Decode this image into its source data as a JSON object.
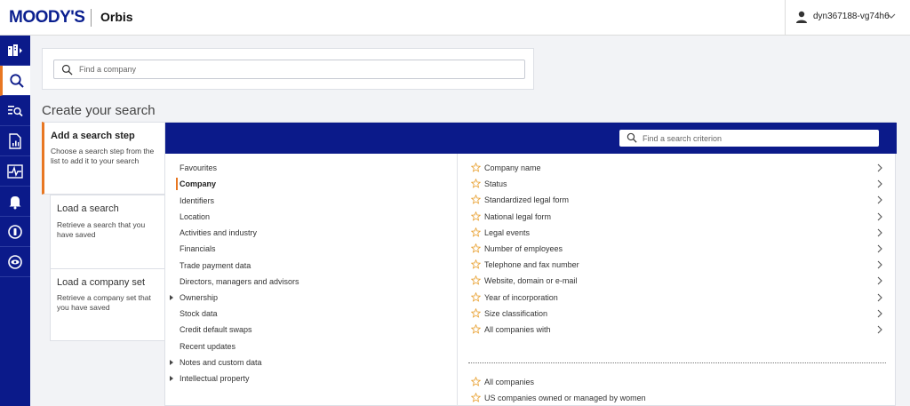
{
  "header": {
    "logo": "MOODY'S",
    "product": "Orbis",
    "user": "dyn367188-vg74h6"
  },
  "search": {
    "placeholder": "Find a company"
  },
  "section_title": "Create your search",
  "steps": [
    {
      "title": "Add a search step",
      "desc": "Choose a search step from the list to add it to your search"
    },
    {
      "title": "Load a search",
      "desc": "Retrieve a search that you have saved"
    },
    {
      "title": "Load a company set",
      "desc": "Retrieve a company set that you have saved"
    }
  ],
  "criterion_search": {
    "placeholder": "Find a search criterion"
  },
  "categories": [
    {
      "label": "Favourites",
      "expandable": false,
      "active": false
    },
    {
      "label": "Company",
      "expandable": false,
      "active": true
    },
    {
      "label": "Identifiers",
      "expandable": false,
      "active": false
    },
    {
      "label": "Location",
      "expandable": false,
      "active": false
    },
    {
      "label": "Activities and industry",
      "expandable": false,
      "active": false
    },
    {
      "label": "Financials",
      "expandable": false,
      "active": false
    },
    {
      "label": "Trade payment data",
      "expandable": false,
      "active": false
    },
    {
      "label": "Directors, managers and advisors",
      "expandable": false,
      "active": false
    },
    {
      "label": "Ownership",
      "expandable": true,
      "active": false
    },
    {
      "label": "Stock data",
      "expandable": false,
      "active": false
    },
    {
      "label": "Credit default swaps",
      "expandable": false,
      "active": false
    },
    {
      "label": "Recent updates",
      "expandable": false,
      "active": false
    },
    {
      "label": "Notes and custom data",
      "expandable": true,
      "active": false
    },
    {
      "label": "Intellectual property",
      "expandable": true,
      "active": false
    }
  ],
  "criteria": [
    "Company name",
    "Status",
    "Standardized legal form",
    "National legal form",
    "Legal events",
    "Number of employees",
    "Telephone and fax number",
    "Website, domain or e-mail",
    "Year of incorporation",
    "Size classification",
    "All companies with"
  ],
  "predefined": [
    "All companies",
    "US companies owned or managed by women"
  ],
  "colors": {
    "brand_blue": "#0b1a8a",
    "accent_orange": "#e87722",
    "star": "#e8a030"
  },
  "sidebar_icons": [
    "company-list-icon",
    "search-icon",
    "search-list-icon",
    "report-icon",
    "monitor-icon",
    "bell-icon",
    "info-icon",
    "eye-icon"
  ]
}
